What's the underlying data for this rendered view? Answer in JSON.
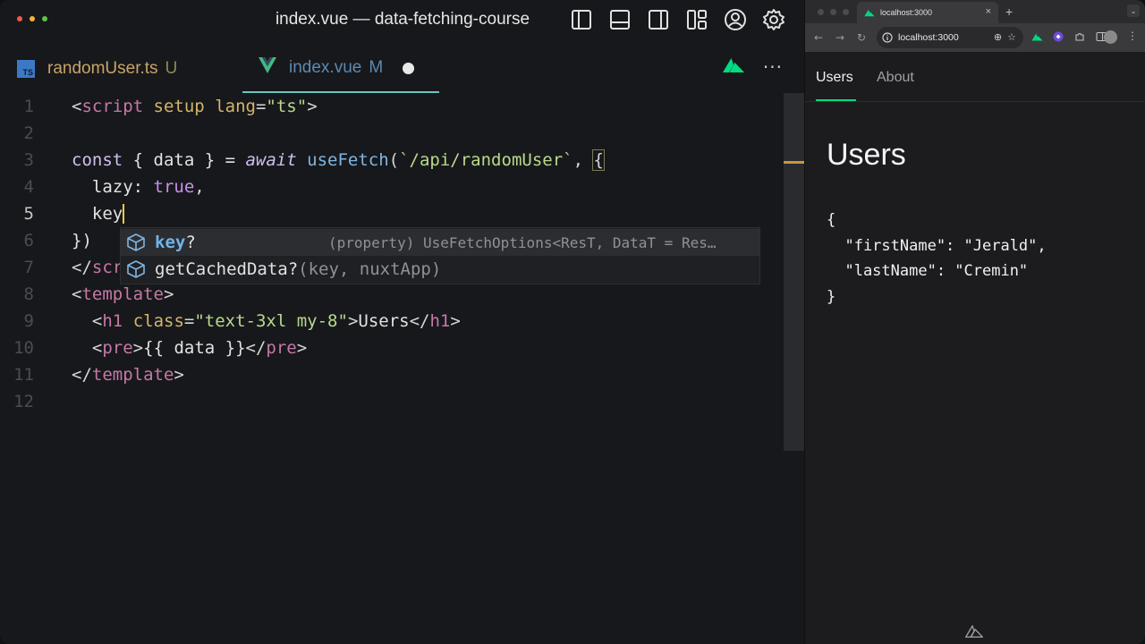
{
  "editor": {
    "title": "index.vue — data-fetching-course",
    "tabs": [
      {
        "icon": "TS",
        "name": "randomUser.ts",
        "status": "U"
      },
      {
        "name": "index.vue",
        "status": "M"
      }
    ],
    "more_label": "···",
    "line_numbers": [
      "1",
      "2",
      "3",
      "4",
      "5",
      "6",
      "7",
      "8",
      "9",
      "10",
      "11",
      "12"
    ],
    "code": {
      "l1": {
        "open": "<",
        "tag": "script",
        "sp1": " ",
        "attr1": "setup",
        "sp2": " ",
        "attr2": "lang",
        "eq": "=",
        "val": "\"ts\"",
        "close": ">"
      },
      "l3": {
        "const": "const",
        "destr": " { data } = ",
        "await": "await",
        "sp": " ",
        "fn": "useFetch",
        "paren": "(",
        "str": "`/api/randomUser`",
        "comma": ", ",
        "brace": "{"
      },
      "l4": {
        "key": "  lazy: ",
        "val": "true",
        "comma": ","
      },
      "l5": {
        "text": "  key"
      },
      "l6": {
        "text": "})"
      },
      "l7": {
        "open": "</",
        "tag": "scr"
      },
      "l8": {
        "open": "<",
        "tag": "template",
        "close": ">"
      },
      "l9": {
        "indent": "  ",
        "open": "<",
        "tag": "h1",
        "sp": " ",
        "attr": "class",
        "eq": "=",
        "val": "\"text-3xl my-8\"",
        "gt": ">",
        "content": "Users",
        "endopen": "</",
        "endtag": "h1",
        "endgt": ">"
      },
      "l10": {
        "indent": "  ",
        "open": "<",
        "tag": "pre",
        "gt": ">",
        "content": "{{ data }}",
        "endopen": "</",
        "endtag": "pre",
        "endgt": ">"
      },
      "l11": {
        "open": "</",
        "tag": "template",
        "close": ">"
      }
    },
    "suggestions": [
      {
        "match": "key",
        "rest": "?",
        "detail": "(property) UseFetchOptions<ResT, DataT = Res…"
      },
      {
        "label": "getCachedData?",
        "params": "(key, nuxtApp)"
      }
    ]
  },
  "browser": {
    "tab_title": "localhost:3000",
    "tab_close": "×",
    "new_tab": "+",
    "url": "localhost:3000",
    "nav": {
      "back": "←",
      "forward": "→",
      "reload": "↻"
    },
    "page": {
      "nav_items": [
        "Users",
        "About"
      ],
      "heading": "Users",
      "pre": "{\n  \"firstName\": \"Jerald\",\n  \"lastName\": \"Cremin\"\n}"
    }
  },
  "colors": {
    "nuxt_green": "#00dc82",
    "vue_green": "#41b883",
    "active_tab_border": "#66c6c1",
    "ts_blue": "#3b79c7"
  }
}
